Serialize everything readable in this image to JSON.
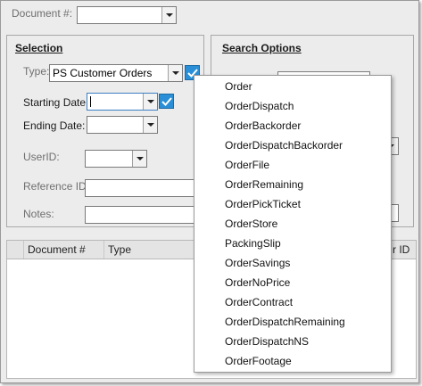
{
  "document": {
    "label": "Document #:",
    "value": ""
  },
  "selection": {
    "title": "Selection",
    "type_label": "Type:",
    "type_value": "PS Customer Orders",
    "starting_date_label": "Starting Date:",
    "starting_date_value": "",
    "ending_date_label": "Ending Date:",
    "ending_date_value": "",
    "userid_label": "UserID:",
    "userid_value": "",
    "reference_label": "Reference ID:",
    "reference_value": "",
    "notes_label": "Notes:",
    "notes_value": ""
  },
  "search_options": {
    "title": "Search Options"
  },
  "grid": {
    "columns": [
      "Document #",
      "Type",
      "r ID"
    ]
  },
  "type_dropdown": {
    "items": [
      "Order",
      "OrderDispatch",
      "OrderBackorder",
      "OrderDispatchBackorder",
      "OrderFile",
      "OrderRemaining",
      "OrderPickTicket",
      "OrderStore",
      "PackingSlip",
      "OrderSavings",
      "OrderNoPrice",
      "OrderContract",
      "OrderDispatchRemaining",
      "OrderDispatchNS",
      "OrderFootage"
    ]
  },
  "colors": {
    "accent": "#2a8fd6",
    "panel": "#ececec"
  }
}
